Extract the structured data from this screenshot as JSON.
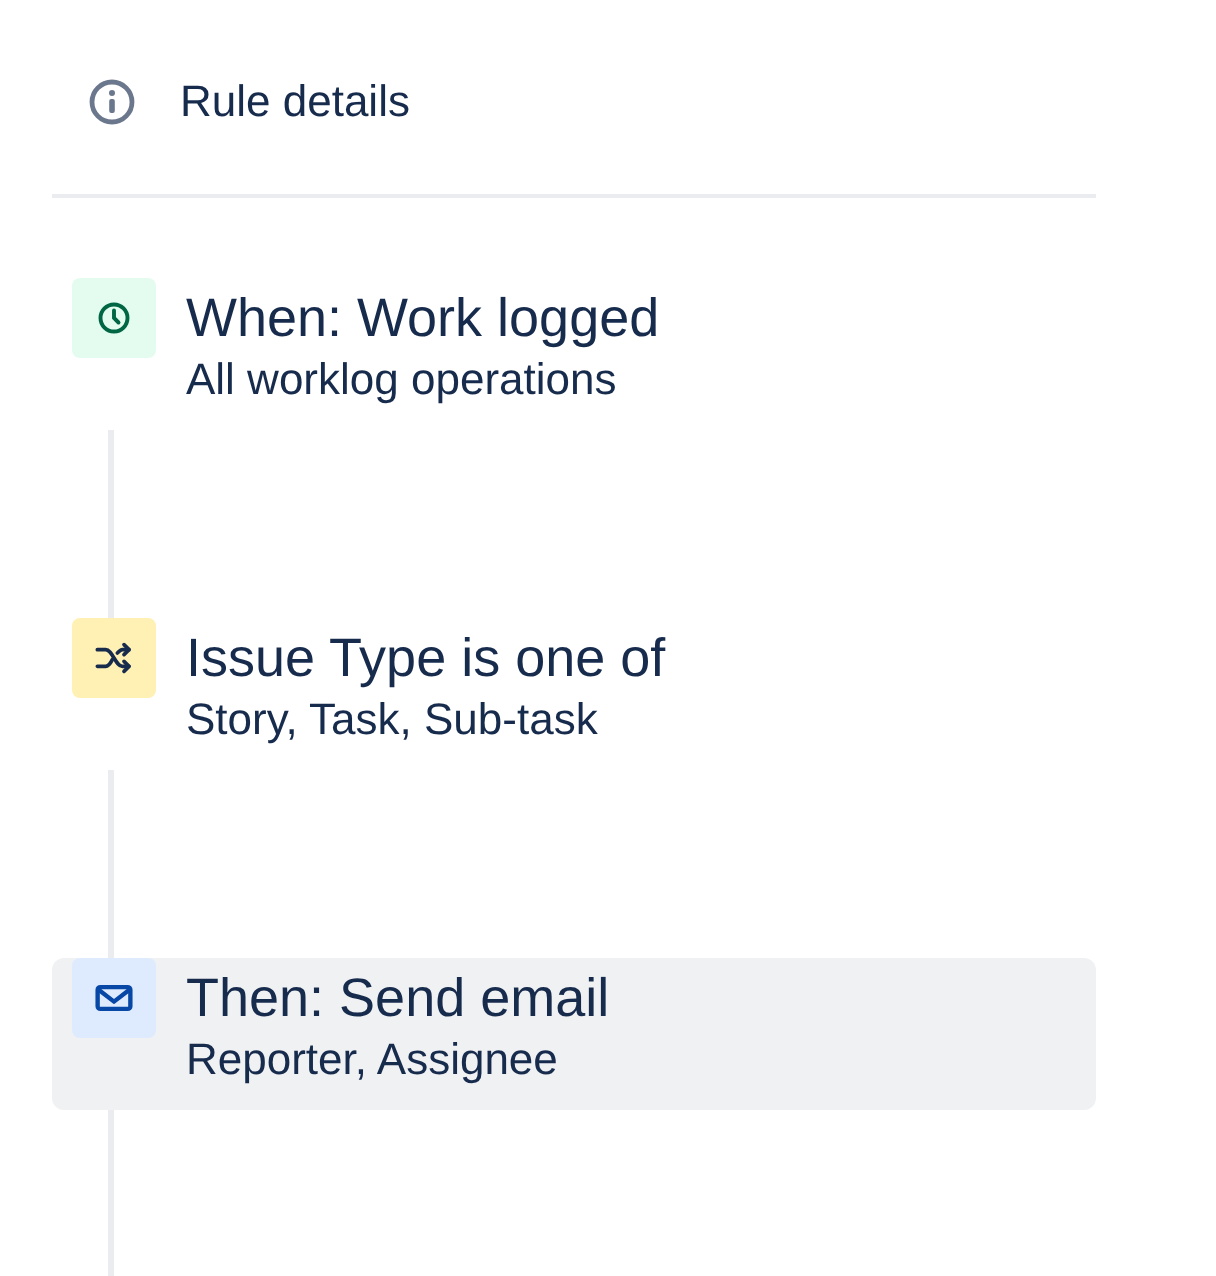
{
  "header": {
    "title": "Rule details"
  },
  "steps": [
    {
      "kind": "trigger",
      "title": "When: Work logged",
      "subtitle": "All worklog operations",
      "selected": false
    },
    {
      "kind": "condition",
      "title": "Issue Type is one of",
      "subtitle": "Story, Task, Sub-task",
      "selected": false
    },
    {
      "kind": "action",
      "title": "Then: Send email",
      "subtitle": "Reporter, Assignee",
      "selected": true
    }
  ]
}
